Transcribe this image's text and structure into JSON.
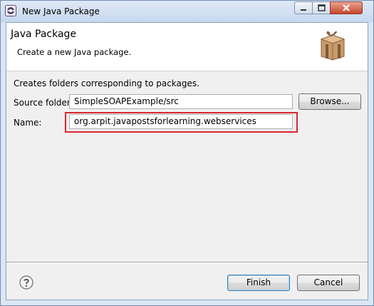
{
  "window": {
    "title": "New Java Package"
  },
  "banner": {
    "title": "Java Package",
    "description": "Create a new Java package."
  },
  "form": {
    "description": "Creates folders corresponding to packages.",
    "source_folder_label": "Source folder:",
    "source_folder_value": "SimpleSOAPExample/src",
    "browse_label": "Browse...",
    "name_label": "Name:",
    "name_value": "org.arpit.javapostsforlearning.webservices"
  },
  "footer": {
    "finish_label": "Finish",
    "cancel_label": "Cancel"
  },
  "colors": {
    "highlight": "#d8262e",
    "titlebar": "#c7d8ee"
  },
  "icons": {
    "app": "eclipse-icon",
    "banner": "package-box-icon",
    "help": "help-icon"
  }
}
